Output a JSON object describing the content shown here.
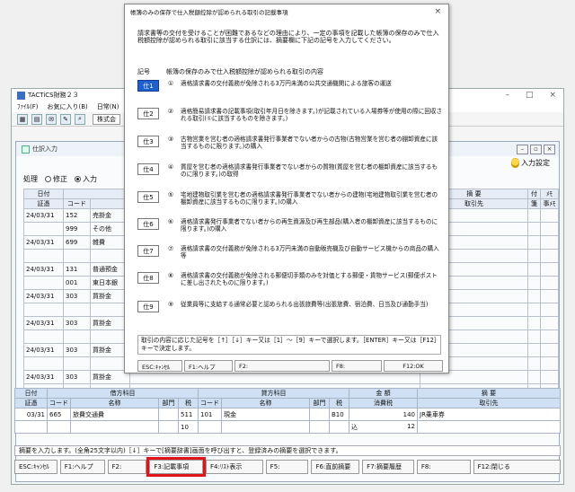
{
  "app": {
    "title": "TACTiCS財務２３",
    "menu": [
      "ﾌｧｲﾙ(F)",
      "お気に入り(B)",
      "日常(N)",
      "決"
    ],
    "company": "株式会",
    "winctl": [
      "–",
      "□",
      "×"
    ]
  },
  "subwindow": {
    "title": "仕訳入力",
    "settings_label": "入力設定",
    "mode_label": "処理",
    "modes": [
      "修正",
      "入力"
    ]
  },
  "ledger": {
    "headers_top": [
      "日付",
      "",
      "",
      "摘 要",
      "付",
      "ﾒﾓ"
    ],
    "headers_bottom": [
      "証憑",
      "コード",
      "",
      "取引先",
      "箋",
      "事ﾒﾓ"
    ],
    "rows": [
      {
        "date": "24/03/31",
        "code": "152",
        "name": "売掛金",
        "memo": ""
      },
      {
        "date": "",
        "code": "999",
        "name": "その他",
        "memo": ""
      },
      {
        "date": "24/03/31",
        "code": "699",
        "name": "雑費",
        "memo": ""
      },
      {
        "date": "",
        "code": "",
        "name": "",
        "memo": ""
      },
      {
        "date": "24/03/31",
        "code": "131",
        "name": "普通預金",
        "memo": "替"
      },
      {
        "date": "",
        "code": "001",
        "name": "東日本銀",
        "memo": ""
      },
      {
        "date": "24/03/31",
        "code": "303",
        "name": "買掛金",
        "memo": ""
      },
      {
        "date": "",
        "code": "",
        "name": "",
        "memo": ""
      },
      {
        "date": "24/03/31",
        "code": "303",
        "name": "買掛金",
        "memo": ""
      },
      {
        "date": "",
        "code": "",
        "name": "",
        "memo": ""
      },
      {
        "date": "24/03/31",
        "code": "303",
        "name": "買掛金",
        "memo": ""
      },
      {
        "date": "",
        "code": "",
        "name": "",
        "memo": ""
      },
      {
        "date": "24/03/31",
        "code": "303",
        "name": "買掛金",
        "memo": ""
      },
      {
        "date": "",
        "code": "",
        "name": "",
        "memo": ""
      }
    ]
  },
  "entry": {
    "h1": [
      "日付",
      "借方科目",
      "貸方科目",
      "金 額",
      "摘 要"
    ],
    "h2": [
      "証憑",
      "コード",
      "名称",
      "部門",
      "税",
      "コード",
      "名称",
      "部門",
      "税",
      "消費税",
      "取引先"
    ],
    "row1": {
      "date": "03/31",
      "dcode": "665",
      "dname": "旅費交通費",
      "dtax": "511",
      "ccode": "101",
      "cname": "現金",
      "ctax": "B10",
      "amount": "140",
      "memo": "JR乗車券"
    },
    "row2": {
      "dtax": "10",
      "taxlabel": "込",
      "tax": "12"
    }
  },
  "status": "摘要を入力します。(全角25文字以内)［↓］キーで[摘要辞書]画面を呼び出すと、登録済みの摘要を選択できます。",
  "fkeys": [
    "ESC:ｷｬﾝｾﾙ",
    "F1:ヘルプ",
    "F2:",
    "F3:記載事項",
    "F4:ﾘｽﾄ表示",
    "F5:",
    "F6:直前摘要",
    "F7:摘要履歴",
    "F8:",
    "F12:閉じる"
  ],
  "dialog": {
    "title": "帳簿のみの保存で仕入税額控除が認められる取引の記載事項",
    "close": "×",
    "intro": "請求書等の交付を受けることが困難であるなどの理由により、一定の事項を記載した帳簿の保存のみで仕入税額控除が認められる取引に該当する仕訳には、摘要欄に下記の記号を入力してください。",
    "head_code": "記号",
    "head_desc": "帳簿の保存のみで仕入税額控除が認められる取引の内容",
    "items": [
      {
        "code": "仕1",
        "no": "①",
        "text": "適格請求書の交付義務が免除される3万円未満の公共交通機関による旅客の運送"
      },
      {
        "code": "仕2",
        "no": "②",
        "text": "適格簡易請求書の記載事項(取引年月日を除きます。)が記載されている入場券等が使用の際に回収される取引(①に該当するものを除きます。)"
      },
      {
        "code": "仕3",
        "no": "③",
        "text": "古物営業を営む者の適格請求書発行事業者でない者からの古物(古物営業を営む者の棚卸資産に該当するものに限ります。)の購入"
      },
      {
        "code": "仕4",
        "no": "④",
        "text": "質屋を営む者の適格請求書発行事業者でない者からの質物(質屋を営む者の棚卸資産に該当するものに限ります。)の取得"
      },
      {
        "code": "仕5",
        "no": "⑤",
        "text": "宅地建物取引業を営む者の適格請求書発行事業者でない者からの建物(宅地建物取引業を営む者の棚卸資産に該当するものに限ります。)の購入"
      },
      {
        "code": "仕6",
        "no": "⑥",
        "text": "適格請求書発行事業者でない者からの再生資源及び再生部品(購入者の棚卸資産に該当するものに限ります。)の購入"
      },
      {
        "code": "仕7",
        "no": "⑦",
        "text": "適格請求書の交付義務が免除される3万円未満の自動販売機及び自動サービス機からの商品の購入等"
      },
      {
        "code": "仕8",
        "no": "⑧",
        "text": "適格請求書の交付義務が免除される郵便切手類のみを対価とする郵便・貨物サービス(郵便ポストに差し出されたものに限ります。)"
      },
      {
        "code": "仕9",
        "no": "⑨",
        "text": "従業員等に支給する通常必要と認められる出張旅費等(出張旅費、宿泊費、日当及び通勤手当)"
      }
    ],
    "message": "取引の内容に応じた記号を［↑］［↓］キー又は［1］～［9］キーで選択します。［ENTER］キー又は［F12］キーで決定します。",
    "fkeys": [
      "ESC:ｷｬﾝｾﾙ",
      "F1:ヘルプ",
      "F2:",
      "F8:",
      "F12:OK"
    ]
  }
}
